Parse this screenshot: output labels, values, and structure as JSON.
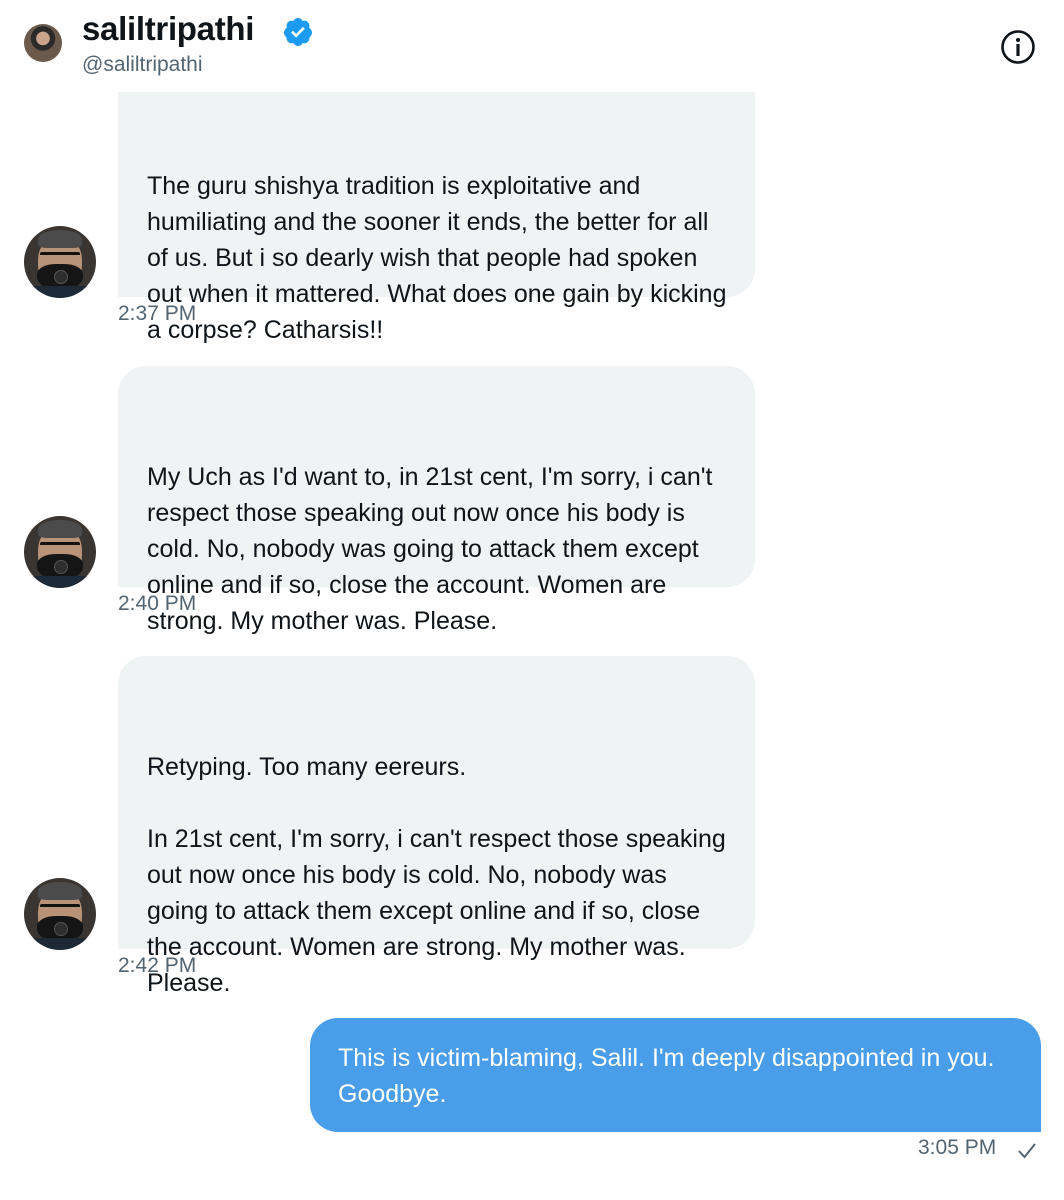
{
  "header": {
    "name": "saliltripathi",
    "handle": "@saliltripathi",
    "verified_color": "#1d9bf0"
  },
  "messages": [
    {
      "text": "The guru shishya tradition is exploitative and humiliating and the sooner it ends, the better for all of us. But i so dearly wish that people had spoken out when it mattered. What does one gain by kicking a corpse? Catharsis!!",
      "time": "2:37 PM"
    },
    {
      "text": "My Uch as I'd want to, in 21st cent, I'm sorry, i can't respect those speaking out now once his body is cold. No, nobody was going to attack them except online and if so, close the account. Women are strong. My mother was. Please.",
      "time": "2:40 PM"
    },
    {
      "text": "Retyping. Too many eereurs.\n\nIn 21st cent, I'm sorry, i can't respect those speaking out now once his body is cold. No, nobody was going to attack them except online and if so, close the account. Women are strong. My mother was. Please.",
      "time": "2:42 PM"
    }
  ],
  "reply": {
    "text": "This is victim-blaming, Salil. I'm deeply disappointed in you. Goodbye.",
    "time": "3:05 PM",
    "bubble_color": "#4a9de8"
  },
  "icons": {
    "info": "info-icon",
    "verified": "verified-badge-icon",
    "sent": "check-icon"
  }
}
